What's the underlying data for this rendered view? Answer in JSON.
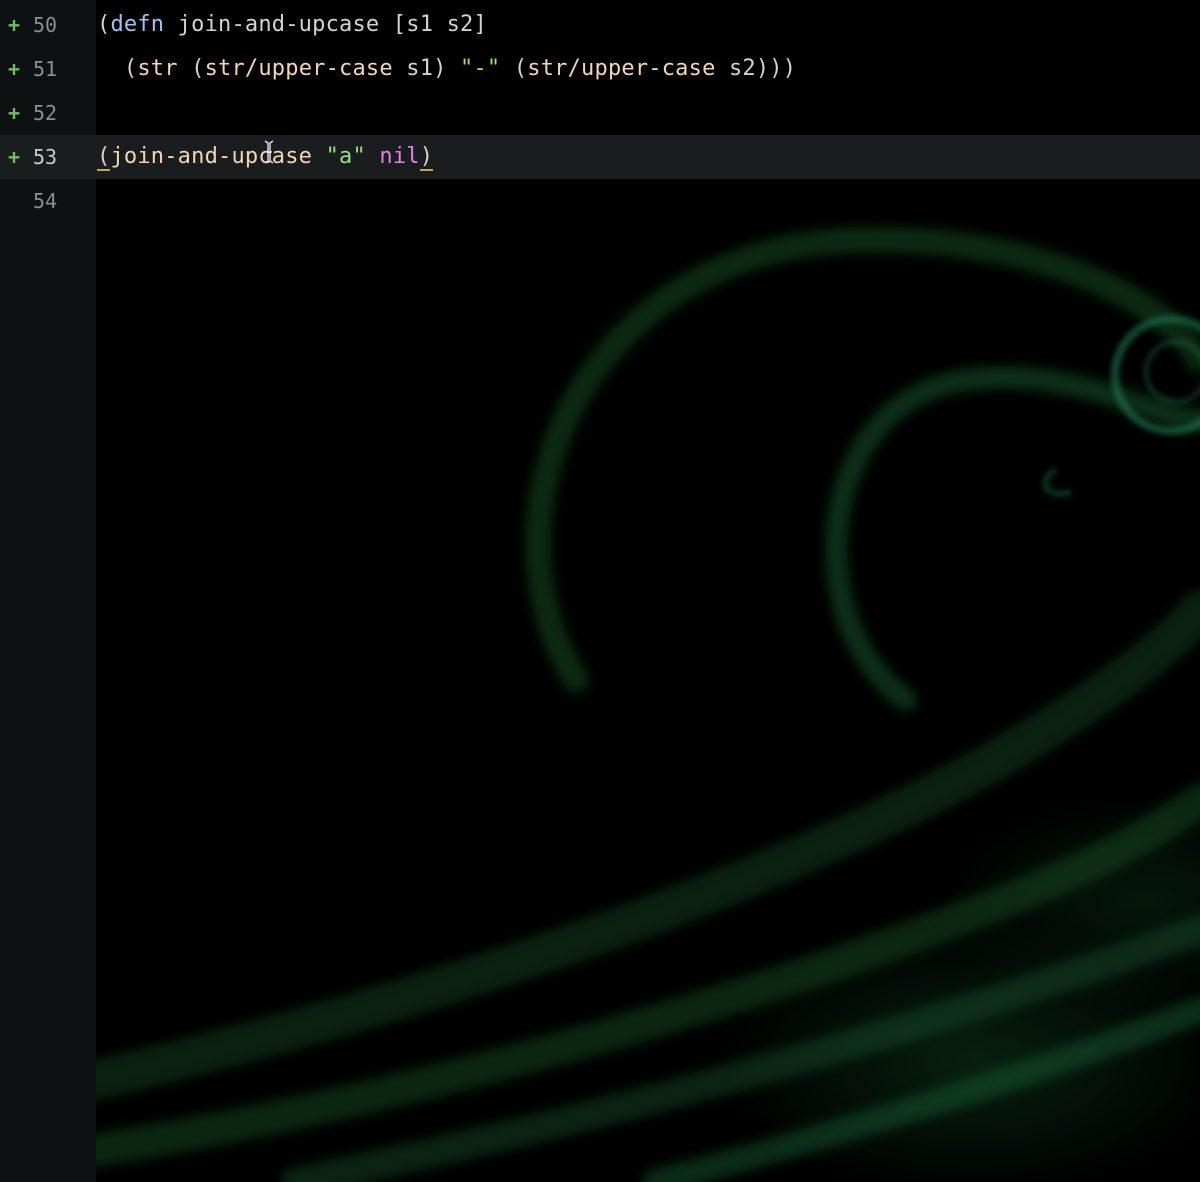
{
  "editor": {
    "lines": [
      {
        "number": "50",
        "added": true,
        "tokens": [
          {
            "t": "(",
            "k": "paren"
          },
          {
            "t": "defn",
            "k": "kw"
          },
          {
            "t": " join-and-upcase [s1 s2]",
            "k": "sym"
          }
        ]
      },
      {
        "number": "51",
        "added": true,
        "tokens": [
          {
            "t": "  (",
            "k": "paren"
          },
          {
            "t": "str",
            "k": "fn"
          },
          {
            "t": " (",
            "k": "paren"
          },
          {
            "t": "str/upper-case",
            "k": "fn"
          },
          {
            "t": " s1) ",
            "k": "sym"
          },
          {
            "t": "\"-\"",
            "k": "str"
          },
          {
            "t": " (",
            "k": "paren"
          },
          {
            "t": "str/upper-case",
            "k": "fn"
          },
          {
            "t": " s2)))",
            "k": "sym"
          }
        ]
      },
      {
        "number": "52",
        "added": true,
        "tokens": []
      },
      {
        "number": "53",
        "added": true,
        "current": true,
        "tokens": [
          {
            "t": "(",
            "k": "paren",
            "match": true
          },
          {
            "t": "join-and-upcase",
            "k": "fn"
          },
          {
            "t": " ",
            "k": "sym"
          },
          {
            "t": "\"a\"",
            "k": "str"
          },
          {
            "t": " ",
            "k": "sym"
          },
          {
            "t": "nil",
            "k": "nil"
          },
          {
            "t": ")",
            "k": "paren",
            "match": true
          }
        ]
      },
      {
        "number": "54",
        "added": false,
        "tokens": []
      }
    ],
    "added_marker": "+"
  },
  "colors": {
    "keyword": "#9cc4f2",
    "function": "#f2d6b0",
    "string": "#98e07a",
    "nil": "#e77ee6",
    "added_marker": "#6fbf5a",
    "bracket_match": "#c9a44a"
  }
}
